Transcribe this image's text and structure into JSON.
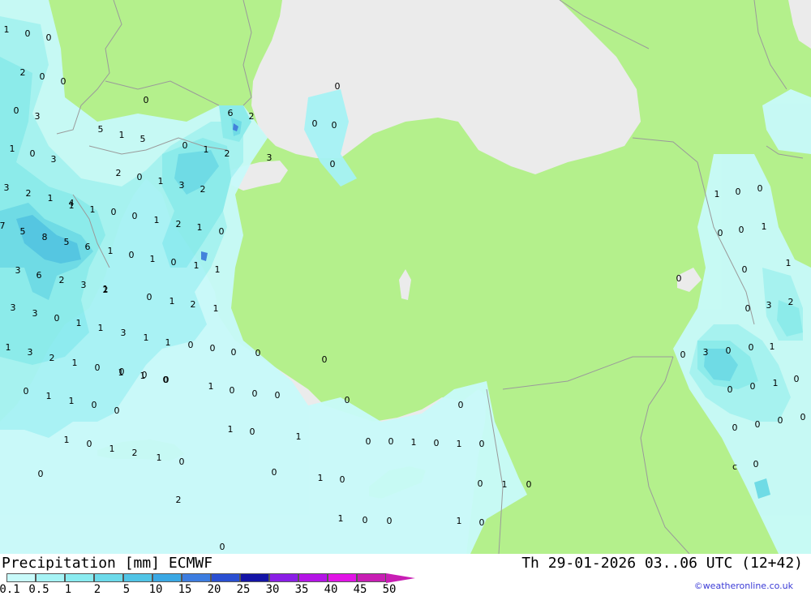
{
  "title": "Precipitation [mm] ECMWF",
  "valid_time": "Th 29-01-2026 03..06 UTC (12+42)",
  "credit": "©weatheronline.co.uk",
  "colors": {
    "land": "#b4f08c",
    "sea": "#ebebeb",
    "border": "#9a9a9a"
  },
  "legend": {
    "ticks": [
      "0.1",
      "0.5",
      "1",
      "2",
      "5",
      "10",
      "15",
      "20",
      "25",
      "30",
      "35",
      "40",
      "45",
      "50"
    ],
    "colors": [
      "#c8fafa",
      "#a6f3f5",
      "#8aebf0",
      "#6cdaea",
      "#50c4e6",
      "#3aa8e4",
      "#3d7de0",
      "#2a4fd2",
      "#1414a6",
      "#8a1ee6",
      "#b414e6",
      "#e114e6",
      "#c81eb4"
    ]
  },
  "values": [
    {
      "text": "1"
    },
    {
      "text": "0"
    },
    {
      "text": "0"
    },
    {
      "text": "2"
    },
    {
      "text": "0"
    },
    {
      "text": "0"
    },
    {
      "text": "0"
    },
    {
      "text": "0"
    },
    {
      "text": "3"
    },
    {
      "text": "1"
    },
    {
      "text": "0"
    },
    {
      "text": "3"
    },
    {
      "text": "3"
    },
    {
      "text": "2"
    },
    {
      "text": "1"
    },
    {
      "text": "4"
    },
    {
      "text": "7"
    },
    {
      "text": "5"
    },
    {
      "text": "8"
    },
    {
      "text": "5"
    },
    {
      "text": "6"
    },
    {
      "text": "3"
    },
    {
      "text": "6"
    },
    {
      "text": "2"
    },
    {
      "text": "3"
    },
    {
      "text": "2"
    },
    {
      "text": "3"
    },
    {
      "text": "3"
    },
    {
      "text": "0"
    },
    {
      "text": "1"
    },
    {
      "text": "1"
    },
    {
      "text": "3"
    },
    {
      "text": "1"
    },
    {
      "text": "3"
    },
    {
      "text": "2"
    },
    {
      "text": "1"
    },
    {
      "text": "0"
    },
    {
      "text": "1"
    },
    {
      "text": "1"
    },
    {
      "text": "0"
    },
    {
      "text": "0"
    },
    {
      "text": "1"
    },
    {
      "text": "1"
    },
    {
      "text": "0"
    },
    {
      "text": "0"
    },
    {
      "text": "0"
    },
    {
      "text": "1"
    },
    {
      "text": "2"
    },
    {
      "text": "1"
    },
    {
      "text": "0"
    },
    {
      "text": "1"
    },
    {
      "text": "0"
    },
    {
      "text": "2"
    },
    {
      "text": "5"
    },
    {
      "text": "1"
    },
    {
      "text": "5"
    },
    {
      "text": "0"
    },
    {
      "text": "1"
    },
    {
      "text": "2"
    },
    {
      "text": "2"
    },
    {
      "text": "0"
    },
    {
      "text": "1"
    },
    {
      "text": "3"
    },
    {
      "text": "2"
    },
    {
      "text": "1"
    },
    {
      "text": "1"
    },
    {
      "text": "0"
    },
    {
      "text": "0"
    },
    {
      "text": "1"
    },
    {
      "text": "2"
    },
    {
      "text": "1"
    },
    {
      "text": "0"
    },
    {
      "text": "6"
    },
    {
      "text": "2"
    },
    {
      "text": "3"
    },
    {
      "text": "1"
    },
    {
      "text": "0"
    },
    {
      "text": "1"
    },
    {
      "text": "0"
    },
    {
      "text": "1"
    },
    {
      "text": "1"
    },
    {
      "text": "1"
    },
    {
      "text": "0"
    },
    {
      "text": "1"
    },
    {
      "text": "2"
    },
    {
      "text": "1"
    },
    {
      "text": "1"
    },
    {
      "text": "1"
    },
    {
      "text": "0"
    },
    {
      "text": "0"
    },
    {
      "text": "0"
    },
    {
      "text": "0"
    },
    {
      "text": "0"
    },
    {
      "text": "0"
    },
    {
      "text": "0"
    },
    {
      "text": "1"
    },
    {
      "text": "0"
    },
    {
      "text": "0"
    },
    {
      "text": "0"
    },
    {
      "text": "1"
    },
    {
      "text": "0"
    },
    {
      "text": "1"
    },
    {
      "text": "0"
    },
    {
      "text": "0"
    },
    {
      "text": "0"
    },
    {
      "text": "0"
    },
    {
      "text": "0"
    },
    {
      "text": "0"
    },
    {
      "text": "0"
    },
    {
      "text": "0"
    },
    {
      "text": "1"
    },
    {
      "text": "0"
    },
    {
      "text": "1"
    },
    {
      "text": "0"
    },
    {
      "text": "0"
    },
    {
      "text": "1"
    },
    {
      "text": "0"
    },
    {
      "text": "1"
    },
    {
      "text": "0"
    },
    {
      "text": "0"
    },
    {
      "text": "1"
    },
    {
      "text": "0"
    },
    {
      "text": "0"
    },
    {
      "text": "1"
    },
    {
      "text": "0"
    },
    {
      "text": "0"
    },
    {
      "text": "0"
    },
    {
      "text": "1"
    },
    {
      "text": "0"
    },
    {
      "text": "0"
    },
    {
      "text": "0"
    },
    {
      "text": "0"
    },
    {
      "text": "1"
    },
    {
      "text": "0"
    },
    {
      "text": "0"
    },
    {
      "text": "1"
    },
    {
      "text": "2"
    },
    {
      "text": "3"
    },
    {
      "text": "0"
    },
    {
      "text": "0"
    },
    {
      "text": "3"
    },
    {
      "text": "0"
    },
    {
      "text": "0"
    },
    {
      "text": "1"
    },
    {
      "text": "0"
    },
    {
      "text": "0"
    },
    {
      "text": "1"
    },
    {
      "text": "0"
    },
    {
      "text": "0"
    },
    {
      "text": "0"
    },
    {
      "text": "0"
    },
    {
      "text": "0"
    },
    {
      "text": "0"
    },
    {
      "text": "c"
    }
  ]
}
